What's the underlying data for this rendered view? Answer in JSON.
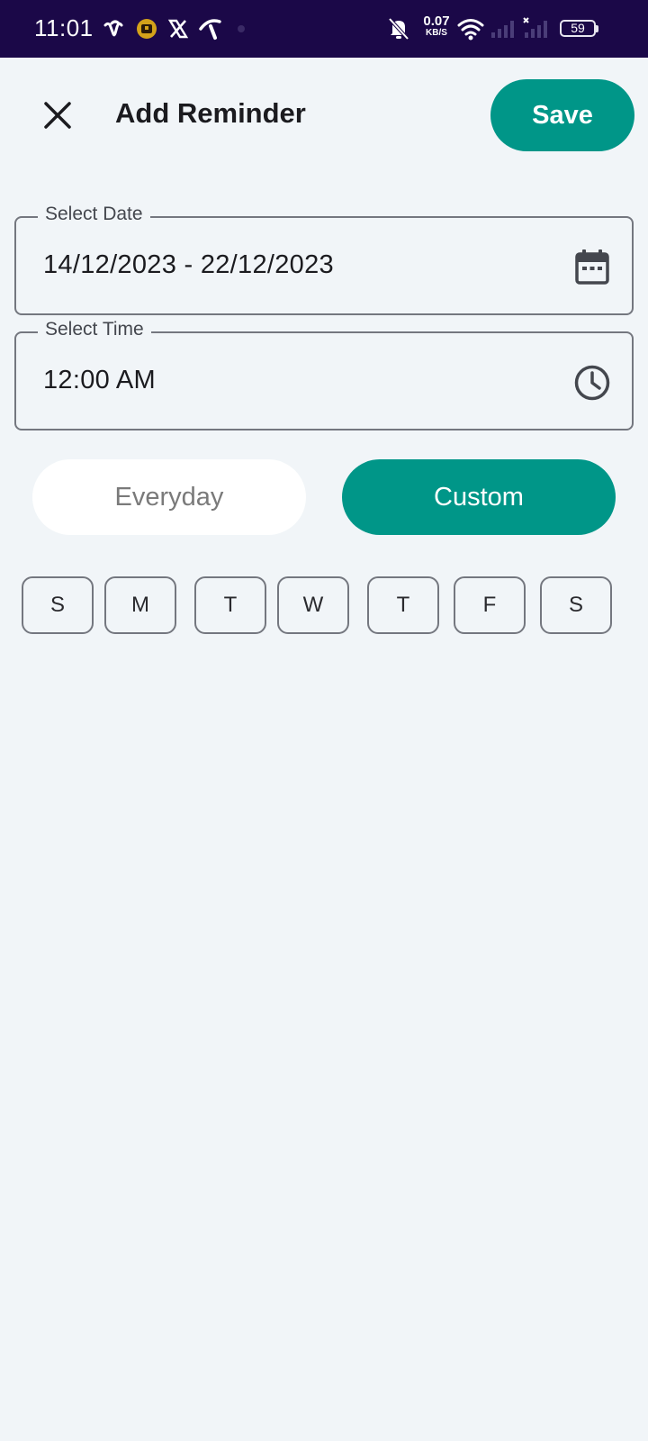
{
  "status_bar": {
    "time": "11:01",
    "net_speed_value": "0.07",
    "net_speed_unit": "KB/S",
    "battery_level": "59",
    "icons": [
      "wave-app-icon",
      "coin-app-icon",
      "x-app-icon",
      "carrier-app-icon",
      "bell-off-icon",
      "wifi-icon",
      "signal-icon",
      "signal-no-sim-icon",
      "battery-icon"
    ]
  },
  "header": {
    "title": "Add Reminder",
    "save_label": "Save",
    "close_icon": "close-icon"
  },
  "date_field": {
    "label": "Select Date",
    "value": "14/12/2023 - 22/12/2023",
    "icon": "calendar-icon"
  },
  "time_field": {
    "label": "Select Time",
    "value": "12:00 AM",
    "icon": "clock-icon"
  },
  "repeat": {
    "options": [
      "Everyday",
      "Custom"
    ],
    "selected": "Custom"
  },
  "days": [
    "S",
    "M",
    "T",
    "W",
    "T",
    "F",
    "S"
  ],
  "colors": {
    "accent": "#009688",
    "status_bar": "#1b0848",
    "background": "#f1f5f8"
  }
}
